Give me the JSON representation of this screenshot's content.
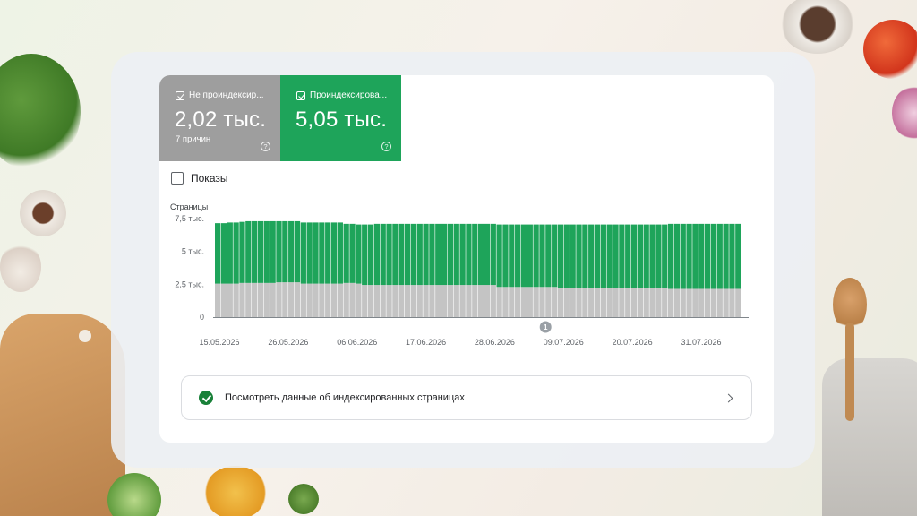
{
  "tiles": [
    {
      "label": "Не проиндексир...",
      "value": "2,02 тыс.",
      "sub": "7 причин",
      "color": "#9e9e9e"
    },
    {
      "label": "Проиндексирова...",
      "value": "5,05 тыс.",
      "sub": "",
      "color": "#1ea45a"
    }
  ],
  "impressions_toggle": {
    "label": "Показы",
    "checked": false
  },
  "link": {
    "label": "Посмотреть данные об индексированных страницах"
  },
  "chart_data": {
    "type": "bar",
    "stacked": true,
    "ylabel": "Страницы",
    "yticks": [
      "7,5 тыс.",
      "5 тыс.",
      "2,5 тыс.",
      "0"
    ],
    "ylim": [
      0,
      7500
    ],
    "x_tick_labels": [
      "15.05.2026",
      "26.05.2026",
      "06.06.2026",
      "17.06.2026",
      "28.06.2026",
      "09.07.2026",
      "20.07.2026",
      "31.07.2026"
    ],
    "annotation": "1",
    "grid": false,
    "series": [
      {
        "name": "Не проиндексир...",
        "color": "#c4c4c4",
        "values": [
          2550,
          2550,
          2550,
          2550,
          2600,
          2600,
          2600,
          2600,
          2600,
          2600,
          2650,
          2650,
          2650,
          2650,
          2550,
          2550,
          2550,
          2550,
          2550,
          2550,
          2550,
          2600,
          2600,
          2550,
          2450,
          2450,
          2450,
          2450,
          2450,
          2450,
          2450,
          2450,
          2450,
          2450,
          2450,
          2450,
          2450,
          2450,
          2450,
          2450,
          2450,
          2450,
          2450,
          2450,
          2450,
          2450,
          2300,
          2300,
          2300,
          2300,
          2300,
          2300,
          2300,
          2300,
          2300,
          2300,
          2250,
          2250,
          2250,
          2250,
          2250,
          2250,
          2250,
          2250,
          2250,
          2250,
          2250,
          2250,
          2250,
          2250,
          2250,
          2250,
          2250,
          2250,
          2150,
          2150,
          2150,
          2150,
          2150,
          2150,
          2150,
          2150,
          2150,
          2150,
          2150,
          2150
        ]
      },
      {
        "name": "Проиндексирова...",
        "color": "#1ea45a",
        "values": [
          4600,
          4600,
          4650,
          4650,
          4650,
          4700,
          4700,
          4700,
          4700,
          4700,
          4650,
          4650,
          4650,
          4650,
          4650,
          4650,
          4650,
          4650,
          4650,
          4650,
          4650,
          4500,
          4500,
          4500,
          4600,
          4600,
          4650,
          4650,
          4650,
          4650,
          4650,
          4650,
          4650,
          4650,
          4650,
          4650,
          4650,
          4650,
          4650,
          4650,
          4650,
          4650,
          4650,
          4650,
          4650,
          4650,
          4750,
          4750,
          4750,
          4750,
          4750,
          4750,
          4750,
          4750,
          4750,
          4750,
          4800,
          4800,
          4800,
          4800,
          4800,
          4800,
          4800,
          4800,
          4800,
          4800,
          4800,
          4800,
          4800,
          4800,
          4800,
          4800,
          4800,
          4800,
          4950,
          4950,
          4950,
          4950,
          4950,
          4950,
          4950,
          4950,
          4950,
          4950,
          4950,
          4950
        ]
      }
    ]
  }
}
